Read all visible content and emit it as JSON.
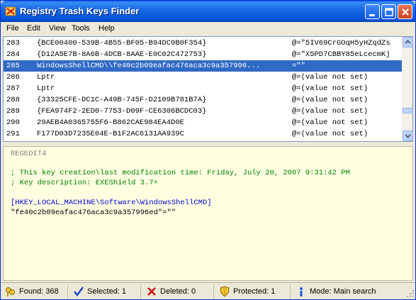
{
  "window": {
    "title": "Registry Trash Keys Finder"
  },
  "menu": [
    "File",
    "Edit",
    "View",
    "Tools",
    "Help"
  ],
  "list": {
    "rows": [
      {
        "num": "283",
        "key": "{BCE00400-539B-4B55-BF05-B94DC9B0F354}",
        "value": "@=\"5IV69CrGOqH5yHZqdZs"
      },
      {
        "num": "284",
        "key": "{D12A5E7B-8A6B-4DCB-8AAE-E0C02C472753}",
        "value": "@=\"X5PD7CBBY85eLcecmKj"
      },
      {
        "num": "285",
        "key": "WindowsShellCMD\\\\fe40c2b09eafac476aca3c9a357996...",
        "value": "=\"\"",
        "selected": true
      },
      {
        "num": "286",
        "key": "Lptr",
        "value": "@=(value not set)"
      },
      {
        "num": "287",
        "key": "Lptr",
        "value": "@=(value not set)"
      },
      {
        "num": "288",
        "key": "{33325CFE-DC1C-A49B-745F-D2109B781B7A}",
        "value": "@=(value not set)"
      },
      {
        "num": "289",
        "key": "{FEA974F2-2ED0-7753-D09F-CE6306BCDC03}",
        "value": "@=(value not set)"
      },
      {
        "num": "290",
        "key": "29AEB4A0365755F6-B862CAE984EA4D0E",
        "value": "@=(value not set)"
      },
      {
        "num": "291",
        "key": "F177D03D7235E04E-B1F2AC6131AA939C",
        "value": "@=(value not set)"
      }
    ]
  },
  "detail": {
    "header": "REGEDIT4",
    "comment1": "; This key creation\\last modification time: Friday, July 20, 2007 9:31:42 PM",
    "comment2": "; Key description: EXEShield 3.7+",
    "key_path": "[HKEY_LOCAL_MACHINE\\Software\\WindowsShellCMD]",
    "value_line": "\"fe40c2b09eafac476aca3c9a357996ed\"=\"\""
  },
  "status": {
    "found": "Found: 368",
    "selected": "Selected: 1",
    "deleted": "Deleted: 0",
    "protected": "Protected: 1",
    "mode": "Mode: Main search"
  },
  "colors": {
    "titlebar": "#0553d8",
    "selection": "#316ac5",
    "comment": "#008000",
    "keypath": "#0000cc",
    "detail_bg": "#ffffe1"
  },
  "icons": {
    "app": "registry-trash-icon",
    "found": "keys-icon",
    "selected": "checkmark-icon",
    "deleted": "red-x-icon",
    "protected": "shield-icon",
    "mode": "info-icon"
  }
}
